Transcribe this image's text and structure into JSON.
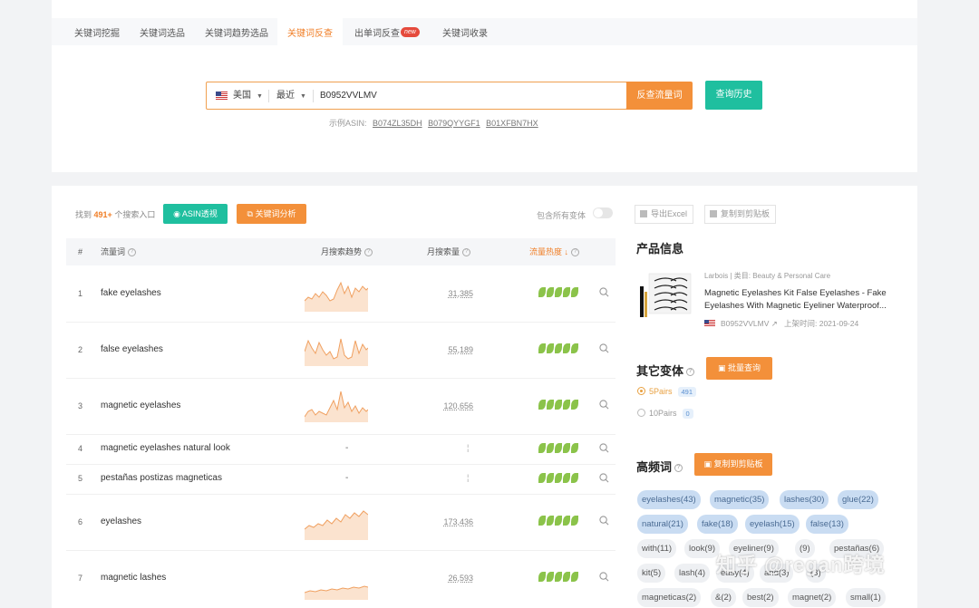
{
  "tabs": [
    {
      "label": "关键词挖掘"
    },
    {
      "label": "关键词选品"
    },
    {
      "label": "关键词趋势选品"
    },
    {
      "label": "关键词反查"
    },
    {
      "label": "出单词反查",
      "badge": "new"
    },
    {
      "label": "关键词收录"
    }
  ],
  "search": {
    "country": "美国",
    "period": "最近",
    "value": "B0952VVLMV",
    "reverse_label": "反查流量词",
    "history_label": "查询历史",
    "examples_label": "示例ASIN:",
    "examples": [
      "B074ZL35DH",
      "B079QYYGF1",
      "B01XFBN7HX"
    ]
  },
  "summary": {
    "found_prefix": "找到",
    "found_count": "491+",
    "found_suffix": "个搜索入口",
    "asin_btn": "ASIN透视",
    "kw_btn": "关键词分析",
    "variants_toggle": "包含所有变体"
  },
  "table": {
    "headers": {
      "num": "#",
      "keyword": "流量词",
      "trend": "月搜索趋势",
      "volume": "月搜索量",
      "heat": "流量热度"
    },
    "rows": [
      {
        "num": "1",
        "keyword": "fake eyelashes",
        "volume": "31,385"
      },
      {
        "num": "2",
        "keyword": "false eyelashes",
        "volume": "55,189"
      },
      {
        "num": "3",
        "keyword": "magnetic eyelashes",
        "volume": "120,656"
      },
      {
        "num": "4",
        "keyword": "magnetic eyelashes natural look",
        "trend_text": "-",
        "volume": ""
      },
      {
        "num": "5",
        "keyword": "pestañas postizas magneticas",
        "trend_text": "-",
        "volume": ""
      },
      {
        "num": "6",
        "keyword": "eyelashes",
        "volume": "173,436"
      },
      {
        "num": "7",
        "keyword": "magnetic lashes",
        "volume": "26,593"
      }
    ]
  },
  "right": {
    "export_label": "导出Excel",
    "copy_label": "复制到剪贴板",
    "product_info_title": "产品信息",
    "brand_line": "Larbois | 类目: Beauty & Personal Care",
    "product_title": "Magnetic Eyelashes Kit False Eyelashes - Fake Eyelashes With Magnetic Eyeliner Waterproof...",
    "asin": "B0952VVLMV",
    "launch": "上架时间: 2021-09-24",
    "other_variants_title": "其它变体",
    "batch_query_label": "批量查询",
    "variants": [
      {
        "name": "5Pairs",
        "count": "491"
      },
      {
        "name": "10Pairs",
        "count": "0"
      }
    ],
    "high_freq_title": "高频词",
    "copy_words_label": "复制到剪贴板",
    "tags": [
      "eyelashes(43)",
      "magnetic(35)",
      "lashes(30)",
      "glue(22)",
      "natural(21)",
      "fake(18)",
      "eyelash(15)",
      "false(13)",
      "with(11)",
      "look(9)",
      "eyeliner(9)",
      "(9)",
      "pestañas(6)",
      "kit(5)",
      "lash(4)",
      "easy(4)",
      "and(3)",
      "(3)",
      "magneticas(2)",
      "&(2)",
      "best(2)",
      "magnet(2)",
      "small(1)"
    ]
  },
  "watermark": "知乎 @regan跨境",
  "colors": {
    "accent_orange": "#f3903a",
    "accent_green": "#1fbf9f",
    "leaf_green": "#8bc34a"
  }
}
